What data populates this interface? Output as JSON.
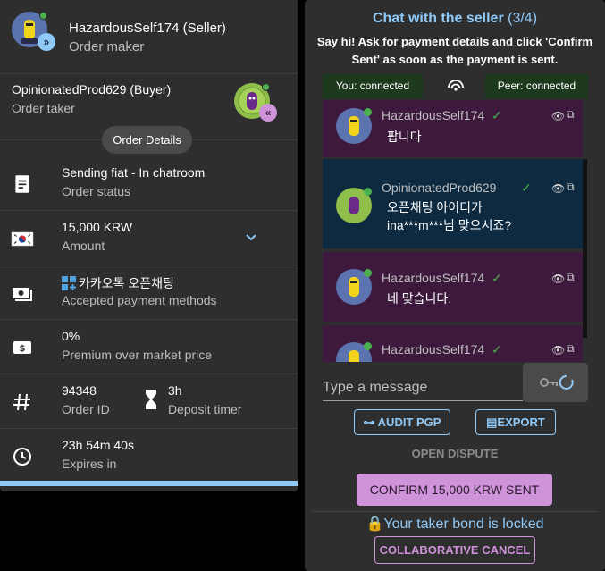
{
  "order": {
    "maker": {
      "name": "HazardousSelf174 (Seller)",
      "role": "Order maker"
    },
    "taker": {
      "name": "OpinionatedProd629 (Buyer)",
      "role": "Order taker"
    },
    "details_chip": "Order Details",
    "status": {
      "value": "Sending fiat - In chatroom",
      "label": "Order status"
    },
    "amount": {
      "value": "15,000 KRW",
      "label": "Amount"
    },
    "payment": {
      "value": "카카오톡 오픈채팅",
      "label": "Accepted payment methods"
    },
    "premium": {
      "value": "0%",
      "label": "Premium over market price"
    },
    "order_id": {
      "value": "94348",
      "label": "Order ID"
    },
    "deposit": {
      "value": "3h",
      "label": "Deposit timer"
    },
    "expires": {
      "value": "23h 54m 40s",
      "label": "Expires in"
    }
  },
  "chat": {
    "title": "Chat with the seller",
    "step": "(3/4)",
    "hint": "Say hi! Ask for payment details and click 'Confirm Sent' as soon as the payment is sent.",
    "you_status": "You: connected",
    "peer_status": "Peer: connected",
    "messages": [
      {
        "user": "HazardousSelf174",
        "text": "팝니다"
      },
      {
        "user": "OpinionatedProd629",
        "text": "오픈채팅 아이디가 ina***m***님 맞으시죠?"
      },
      {
        "user": "HazardousSelf174",
        "text": "네 맞습니다."
      },
      {
        "user": "HazardousSelf174",
        "text": ""
      }
    ],
    "input_placeholder": "Type a message"
  },
  "actions": {
    "audit_pgp": "AUDIT PGP",
    "export": "EXPORT",
    "open_dispute": "OPEN DISPUTE",
    "confirm_sent": "CONFIRM 15,000 KRW SENT",
    "bond_status": "Your taker bond is locked",
    "collaborative_cancel": "COLLABORATIVE CANCEL"
  },
  "colors": {
    "accent_blue": "#90caf9",
    "accent_purple": "#ce93d8",
    "online": "#4caf50",
    "panel": "#2e2e2e"
  }
}
